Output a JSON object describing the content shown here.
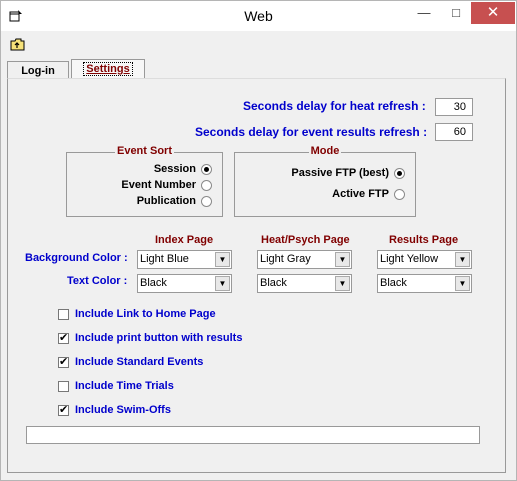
{
  "window": {
    "title": "Web",
    "min_label": "—",
    "max_label": "□",
    "close_label": "✕"
  },
  "tabs": [
    {
      "label": "Log-in"
    },
    {
      "label": "Settings"
    }
  ],
  "refresh": {
    "heat_label": "Seconds delay for heat refresh :",
    "heat_value": "30",
    "event_label": "Seconds delay for event results refresh :",
    "event_value": "60"
  },
  "event_sort": {
    "title": "Event Sort",
    "options": [
      {
        "label": "Session",
        "selected": true
      },
      {
        "label": "Event Number",
        "selected": false
      },
      {
        "label": "Publication",
        "selected": false
      }
    ]
  },
  "mode": {
    "title": "Mode",
    "options": [
      {
        "label": "Passive FTP (best)",
        "selected": true
      },
      {
        "label": "Active FTP",
        "selected": false
      }
    ]
  },
  "pages": {
    "headers": [
      "Index Page",
      "Heat/Psych Page",
      "Results Page"
    ],
    "background_label": "Background Color :",
    "text_label": "Text Color :",
    "background_values": [
      "Light Blue",
      "Light Gray",
      "Light Yellow"
    ],
    "text_values": [
      "Black",
      "Black",
      "Black"
    ]
  },
  "options": [
    {
      "label": "Include Link to Home Page",
      "checked": false
    },
    {
      "label": "Include print button with results",
      "checked": true
    },
    {
      "label": "Include Standard Events",
      "checked": true
    },
    {
      "label": "Include Time Trials",
      "checked": false
    },
    {
      "label": "Include Swim-Offs",
      "checked": true
    }
  ],
  "status_text": "",
  "colors": {
    "label_blue": "#0000cc",
    "header_maroon": "#800000",
    "close_red": "#c75050"
  }
}
